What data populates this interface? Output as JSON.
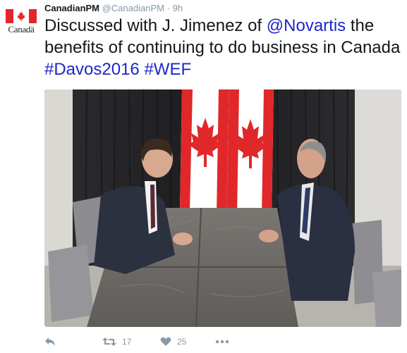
{
  "tweet": {
    "display_name": "CanadianPM",
    "handle": "@CanadianPM",
    "separator": "·",
    "time": "9h",
    "avatar": {
      "wordmark": "Canadä",
      "icon": "canada-flag-icon"
    },
    "text": {
      "part1": "Discussed with J. Jimenez of ",
      "mention": "@Novartis",
      "part2": " the benefits of continuing to do business in Canada ",
      "hashtag1": "#Davos2016",
      "space": " ",
      "hashtag2": "#WEF"
    },
    "link_color": "#1d27c9"
  },
  "actions": {
    "reply": {
      "icon": "reply-icon"
    },
    "retweet": {
      "icon": "retweet-icon",
      "count": "17"
    },
    "like": {
      "icon": "heart-icon",
      "count": "25"
    },
    "more": {
      "icon": "more-icon"
    }
  },
  "colors": {
    "flag_red": "#e4262b",
    "muted": "#8899a6"
  }
}
